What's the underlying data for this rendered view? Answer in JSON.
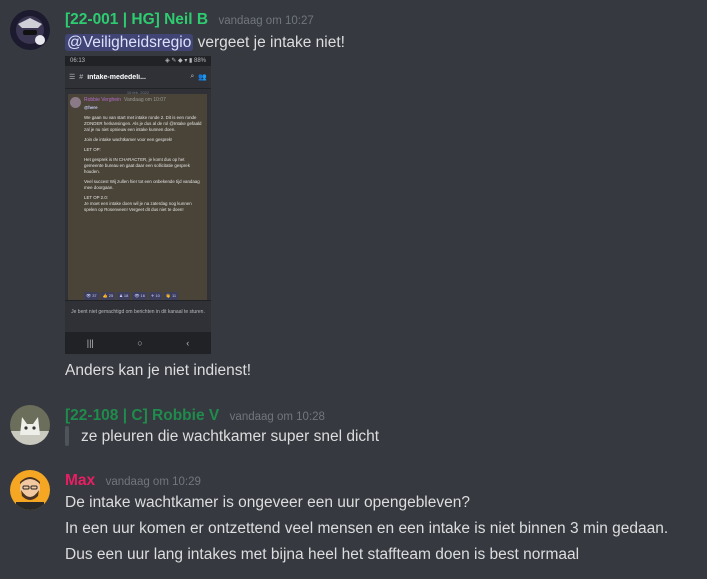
{
  "messages": [
    {
      "username": "[22-001 | HG] Neil B",
      "username_color": "#2ecc71",
      "timestamp": "vandaag om 10:27",
      "mention": "@Veiligheidsregio",
      "text1": "vergeet je intake niet!",
      "text2": "Anders kan je niet indienst!",
      "attachment": {
        "status_time": "06:13",
        "status_icons": "◈ ✎ ◆ ▾ ▮ 88%",
        "channel_title": "intake-mededeli...",
        "date_label": "16 feb. 2022",
        "author": "Robbie Verghein",
        "author_time": "Vandaag om 10:07",
        "here": "@here",
        "paragraphs": [
          "We gaan nu van start met intake ronde 2. Dit is een ronde ZONDER herkansingen. Als je dus al de rol @Intake gefaald zal je nu niet opnieuw een intake kunnen doen.",
          "Join de intake wachtkamer voor een gesprek!",
          "LET OP:",
          "Het gesprek is IN CHARACTER, je komt dus op het gemeente bureau en gaat daar een sollicitatie gesprek houden.",
          "Veel succes! Wij zullen hier tot een onbekende tijd vandaag mee doorgaan.",
          "LET OP 2.0:",
          "Je moet een intake doen wil je na zaterdag nog kunnen spelen op Rosenveen! Vergeet dit dus niet te doen!"
        ],
        "reactions_row1": [
          "👁 37",
          "👍 25",
          "♟ 18",
          "👁 16",
          "✈ 10",
          "👋 11"
        ],
        "reactions_row2": [
          "⛳ 12",
          "😊 11",
          "✈ 11",
          "🔒 13",
          "🔥 10",
          "❗ 12"
        ],
        "notice": "Je bent niet gemachtigd om berichten in dit kanaal te sturen.",
        "nav": [
          "|||",
          "○",
          "‹"
        ]
      }
    },
    {
      "username": "[22-108 | C] Robbie V",
      "username_color": "#1f8b4c",
      "timestamp": "vandaag om 10:28",
      "text1": "ze pleuren die wachtkamer super snel dicht"
    },
    {
      "username": "Max",
      "username_color": "#e91e63",
      "timestamp": "vandaag om 10:29",
      "lines": [
        "De intake wachtkamer is ongeveer een uur opengebleven?",
        "In een uur komen er ontzettend veel mensen en een intake is niet binnen 3 min gedaan.",
        "Dus een uur lang intakes met bijna heel het staffteam doen is best normaal"
      ]
    }
  ]
}
